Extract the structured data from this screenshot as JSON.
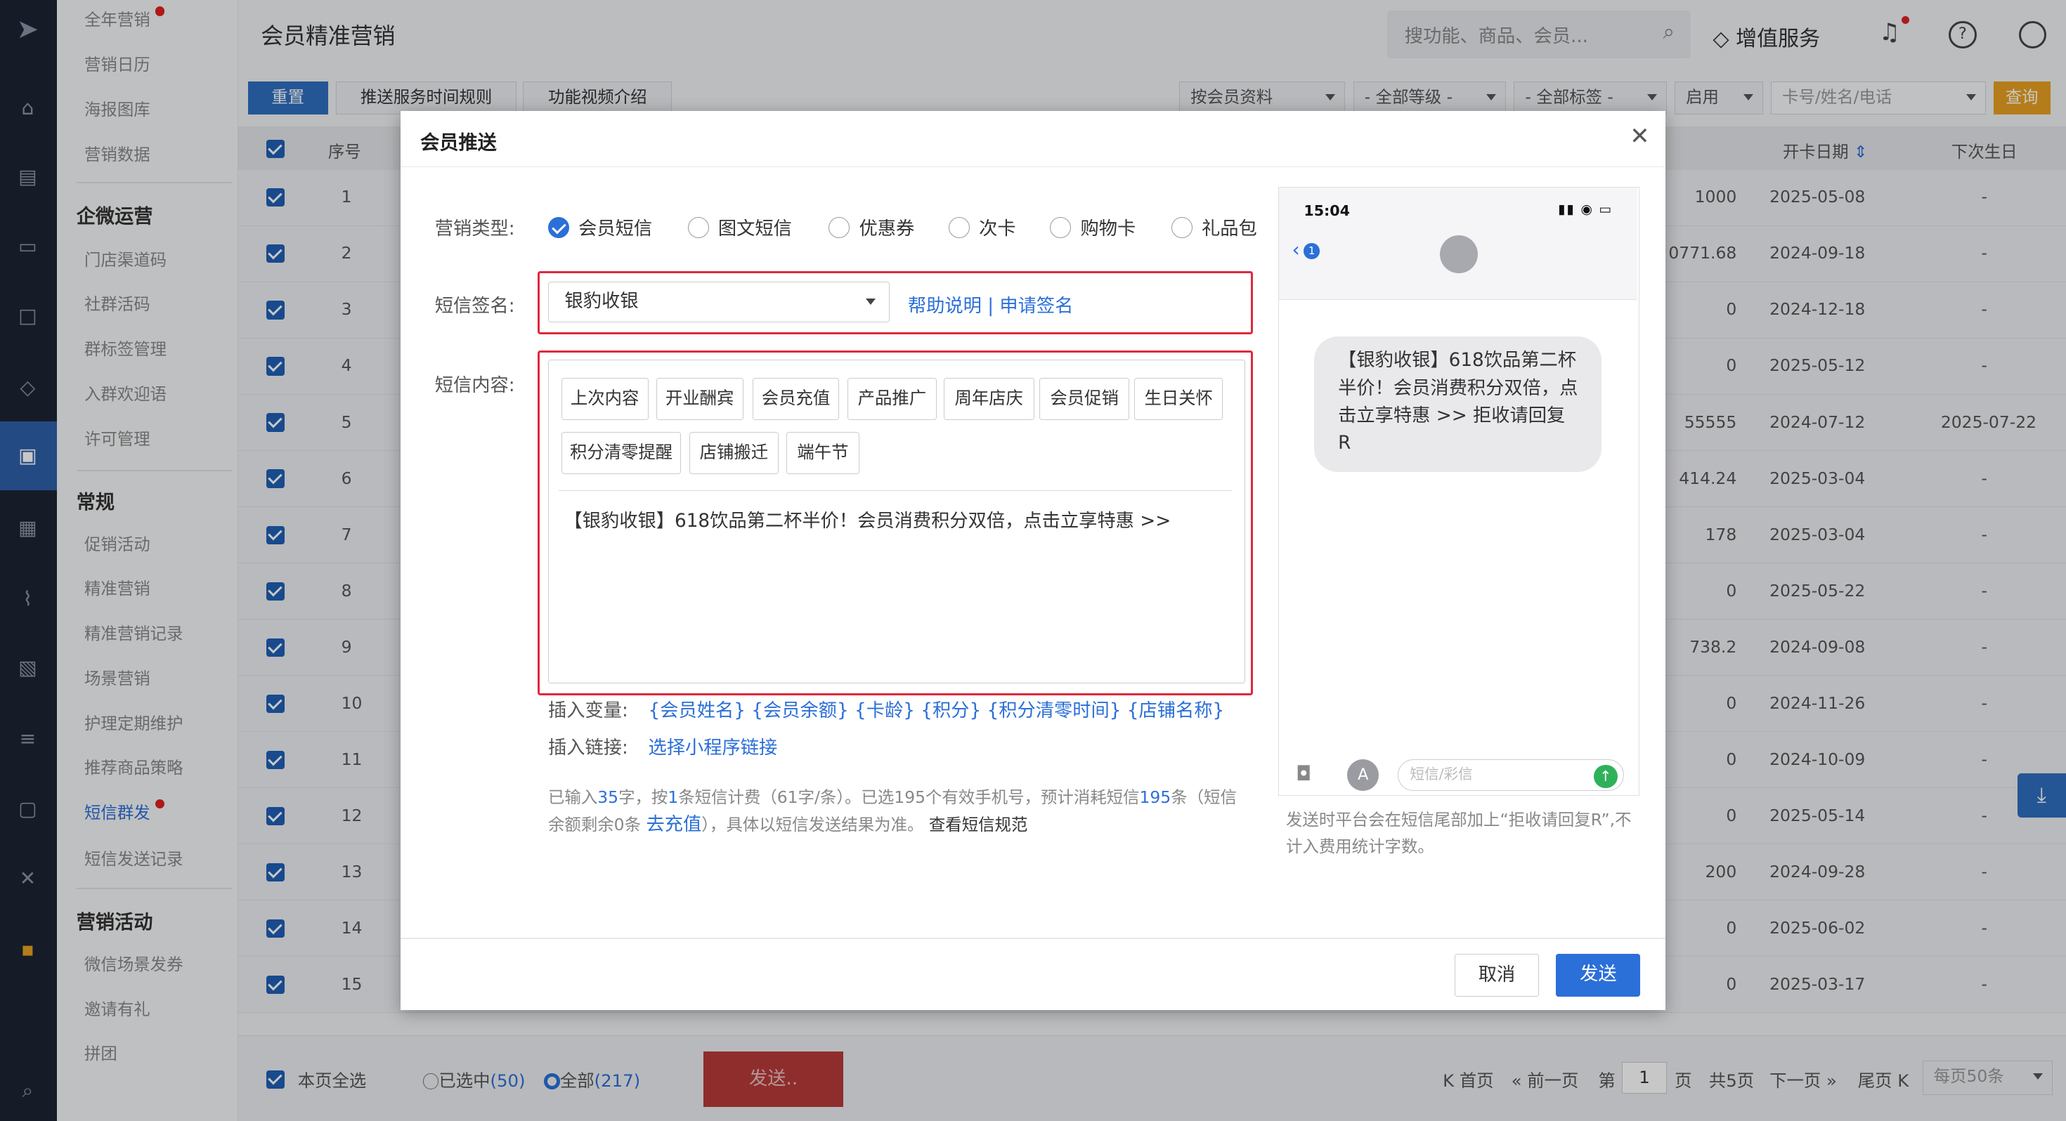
{
  "sidebar": {
    "items": [
      "全年营销",
      "营销日历",
      "海报图库",
      "营销数据"
    ],
    "sections": [
      "企微运营",
      "常规",
      "营销活动"
    ],
    "wechat": [
      "门店渠道码",
      "社群活码",
      "群标签管理",
      "入群欢迎语",
      "许可管理"
    ],
    "general": [
      "促销活动",
      "精准营销",
      "精准营销记录",
      "场景营销",
      "护理定期维护",
      "推荐商品策略",
      "短信群发",
      "短信发送记录"
    ],
    "campaign": [
      "微信场景发券",
      "邀请有礼",
      "拼团"
    ]
  },
  "header": {
    "title": "会员精准营销",
    "search_placeholder": "搜功能、商品、会员...",
    "value_service": "增值服务"
  },
  "toolbar": {
    "reset": "重置",
    "push_rule": "推送服务时间规则",
    "video": "功能视频介绍",
    "filter_member": "按会员资料",
    "filter_level": "- 全部等级 -",
    "filter_tag": "- 全部标签 -",
    "filter_status": "启用",
    "card_placeholder": "卡号/姓名/电话",
    "query": "查询"
  },
  "table": {
    "headers": {
      "index": "序号",
      "open_date": "开卡日期",
      "birthday": "下次生日"
    },
    "rows": [
      {
        "n": "1",
        "v": "1000",
        "d": "2025-05-08",
        "b": "-"
      },
      {
        "n": "2",
        "v": "0771.68",
        "d": "2024-09-18",
        "b": "-"
      },
      {
        "n": "3",
        "v": "0",
        "d": "2024-12-18",
        "b": "-"
      },
      {
        "n": "4",
        "v": "0",
        "d": "2025-05-12",
        "b": "-"
      },
      {
        "n": "5",
        "v": "55555",
        "d": "2024-07-12",
        "b": "2025-07-22"
      },
      {
        "n": "6",
        "v": "414.24",
        "d": "2025-03-04",
        "b": "-"
      },
      {
        "n": "7",
        "v": "178",
        "d": "2025-03-04",
        "b": "-"
      },
      {
        "n": "8",
        "v": "0",
        "d": "2025-05-22",
        "b": "-"
      },
      {
        "n": "9",
        "v": "738.2",
        "d": "2024-09-08",
        "b": "-"
      },
      {
        "n": "10",
        "v": "0",
        "d": "2024-11-26",
        "b": "-"
      },
      {
        "n": "11",
        "v": "0",
        "d": "2024-10-09",
        "b": "-"
      },
      {
        "n": "12",
        "v": "0",
        "d": "2025-05-14",
        "b": "-"
      },
      {
        "n": "13",
        "v": "200",
        "d": "2024-09-28",
        "b": "-"
      },
      {
        "n": "14",
        "v": "0",
        "d": "2025-06-02",
        "b": "-"
      },
      {
        "n": "15",
        "v": "0",
        "d": "2025-03-17",
        "b": "-"
      }
    ]
  },
  "bottom": {
    "select_page": "本页全选",
    "selected": "已选中",
    "selected_count": "(50)",
    "all": "全部",
    "all_count": "(217)",
    "send": "发送..",
    "first": "首页",
    "prev": "前一页",
    "page_label": "第",
    "page": "1",
    "page_unit": "页",
    "total_pages": "共5页",
    "next": "下一页",
    "last": "尾页",
    "per_page": "每页50条"
  },
  "modal": {
    "title": "会员推送",
    "type_label": "营销类型:",
    "types": [
      "会员短信",
      "图文短信",
      "优惠券",
      "次卡",
      "购物卡",
      "礼品包"
    ],
    "sign_label": "短信签名:",
    "sign_value": "银豹收银",
    "help": "帮助说明 | 申请签名",
    "content_label": "短信内容:",
    "templates": [
      "上次内容",
      "开业酬宾",
      "会员充值",
      "产品推广",
      "周年店庆",
      "会员促销",
      "生日关怀",
      "积分清零提醒",
      "店铺搬迁",
      "端午节"
    ],
    "content": "【银豹收银】618饮品第二杯半价！会员消费积分双倍，点击立享特惠 >>",
    "var_label": "插入变量:",
    "vars": [
      "{会员姓名}",
      "{会员余额}",
      "{卡龄}",
      "{积分}",
      "{积分清零时间}",
      "{店铺名称}"
    ],
    "link_label": "插入链接:",
    "link": "选择小程序链接",
    "note1": "已输入",
    "chars": "35",
    "note2": "字，按",
    "pieces": "1",
    "note3": "条短信计费（61字/条）。已选195个有效手机号，预计消耗短信",
    "count": "195",
    "note4": "条（短信余额剩余0条",
    "recharge": "去充值",
    "note5": "），具体以短信发送结果为准。",
    "rules": "查看短信规范",
    "phone": {
      "time": "15:04",
      "badge": "1",
      "message": "【银豹收银】618饮品第二杯半价！会员消费积分双倍，点击立享特惠 >> 拒收请回复R",
      "input_placeholder": "短信/彩信"
    },
    "phone_note": "发送时平台会在短信尾部加上“拒收请回复R”,不计入费用统计字数。",
    "cancel": "取消",
    "send": "发送"
  },
  "colors": {
    "primary": "#2b6fd8",
    "highlight": "#e0283c",
    "rail": "#1d2433",
    "checkbox": "#1f5fb5",
    "send_disabled": "#b83a3a"
  }
}
